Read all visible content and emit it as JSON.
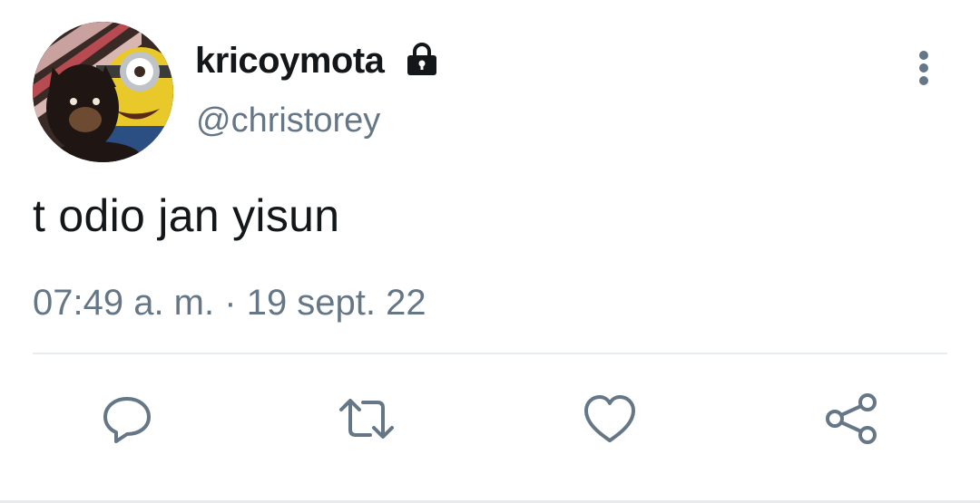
{
  "tweet": {
    "display_name": "kricoymota",
    "handle": "@christorey",
    "text": "t odio jan yisun",
    "time": "07:49 a. m.",
    "separator": "·",
    "date": "19 sept. 22",
    "protected_icon": "lock-icon",
    "more_icon": "more-vertical-icon"
  },
  "actions": [
    {
      "icon": "reply-icon"
    },
    {
      "icon": "retweet-icon"
    },
    {
      "icon": "like-icon"
    },
    {
      "icon": "share-icon"
    }
  ],
  "colors": {
    "text_primary": "#14171a",
    "text_secondary": "#657786",
    "icon_gray": "#657786",
    "divider": "#e6ecf0"
  }
}
